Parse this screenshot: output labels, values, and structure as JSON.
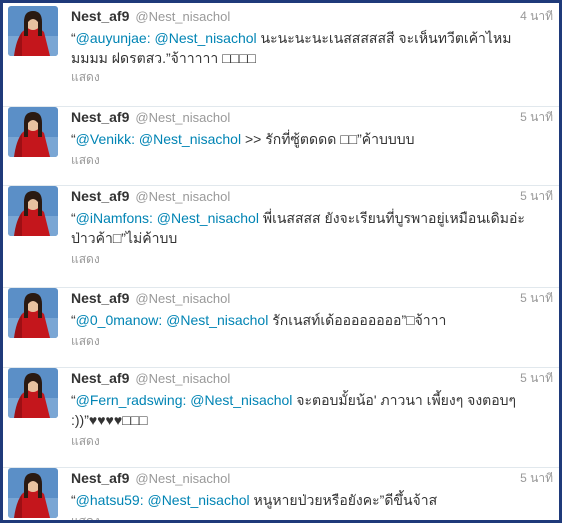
{
  "tweets": [
    {
      "name": "Nest_af9",
      "handle": "@Nest_nisachol",
      "time": "4 นาที",
      "quote_open": "“",
      "mention1": "@auyunjae:",
      "mention2": "@Nest_nisachol",
      "body": " นะนะนะนะเนสสสสสสี จะเห็นทวีตเค้าไหมมมมม ฝดรตสว.”จ้าาาาา □□□□",
      "show_label": "แสดง"
    },
    {
      "name": "Nest_af9",
      "handle": "@Nest_nisachol",
      "time": "5 นาที",
      "quote_open": "“",
      "mention1": "@Venikk:",
      "mention2": "@Nest_nisachol",
      "body": " >> รักที่ซู้ตดดด □□”ค้าบบบบ",
      "show_label": "แสดง"
    },
    {
      "name": "Nest_af9",
      "handle": "@Nest_nisachol",
      "time": "5 นาที",
      "quote_open": "“",
      "mention1": "@iNamfons:",
      "mention2": "@Nest_nisachol",
      "body": " พี่เนสสสส ยังจะเรียนที่บูรพาอยู่เหมือนเดิมอ่ะป่าวค้า□”ไม่ค้าบบ",
      "show_label": "แสดง"
    },
    {
      "name": "Nest_af9",
      "handle": "@Nest_nisachol",
      "time": "5 นาที",
      "quote_open": "“",
      "mention1": "@0_0manow:",
      "mention2": "@Nest_nisachol",
      "body": " รักเนสท์เด้ออออออออ”□จ้าาา",
      "show_label": "แสดง"
    },
    {
      "name": "Nest_af9",
      "handle": "@Nest_nisachol",
      "time": "5 นาที",
      "quote_open": "“",
      "mention1": "@Fern_radswing:",
      "mention2": "@Nest_nisachol",
      "body": " จะตอบมั้ยน้อ' ภาวนา เพี้ยงๆ จงตอบๆ :))”♥♥♥♥□□□",
      "show_label": "แสดง"
    },
    {
      "name": "Nest_af9",
      "handle": "@Nest_nisachol",
      "time": "5 นาที",
      "quote_open": "“",
      "mention1": "@hatsu59:",
      "mention2": "@Nest_nisachol",
      "body": " หนูหายป่วยหรือยังคะ”ดีขึ้นจ้าส",
      "show_label": "แสดง"
    }
  ]
}
